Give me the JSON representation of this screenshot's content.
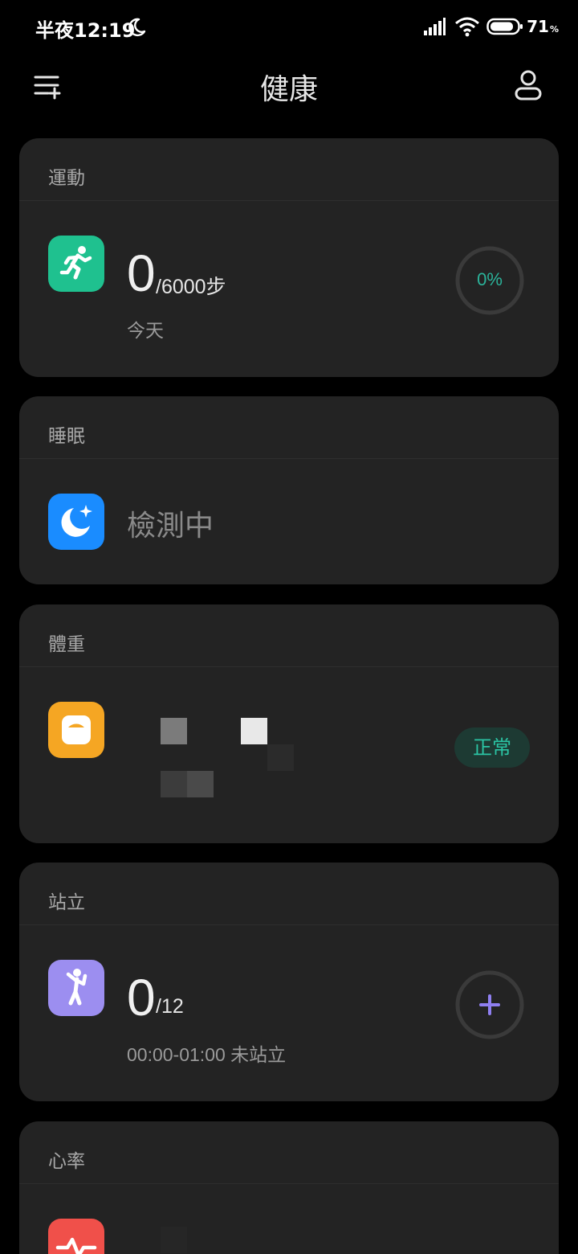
{
  "status_bar": {
    "time": "半夜12:19",
    "battery": "71",
    "battery_unit": "%"
  },
  "header": {
    "title": "健康"
  },
  "cards": {
    "exercise": {
      "title": "運動",
      "value": "0",
      "goal": "/6000步",
      "period": "今天",
      "progress_label": "0%",
      "progress": 0
    },
    "sleep": {
      "title": "睡眠",
      "status": "檢測中"
    },
    "weight": {
      "title": "體重",
      "status": "正常"
    },
    "stand": {
      "title": "站立",
      "value": "0",
      "goal": "/12",
      "detail": "00:00-01:00 未站立"
    },
    "heart_rate": {
      "title": "心率"
    }
  },
  "colors": {
    "exercise_icon": "#1fc18f",
    "sleep_icon": "#1a8cff",
    "weight_icon": "#f5a623",
    "stand_icon": "#9c8ef0",
    "heart_icon": "#f0504a",
    "accent_teal": "#2bb39a",
    "accent_purple": "#8f7ff0"
  }
}
